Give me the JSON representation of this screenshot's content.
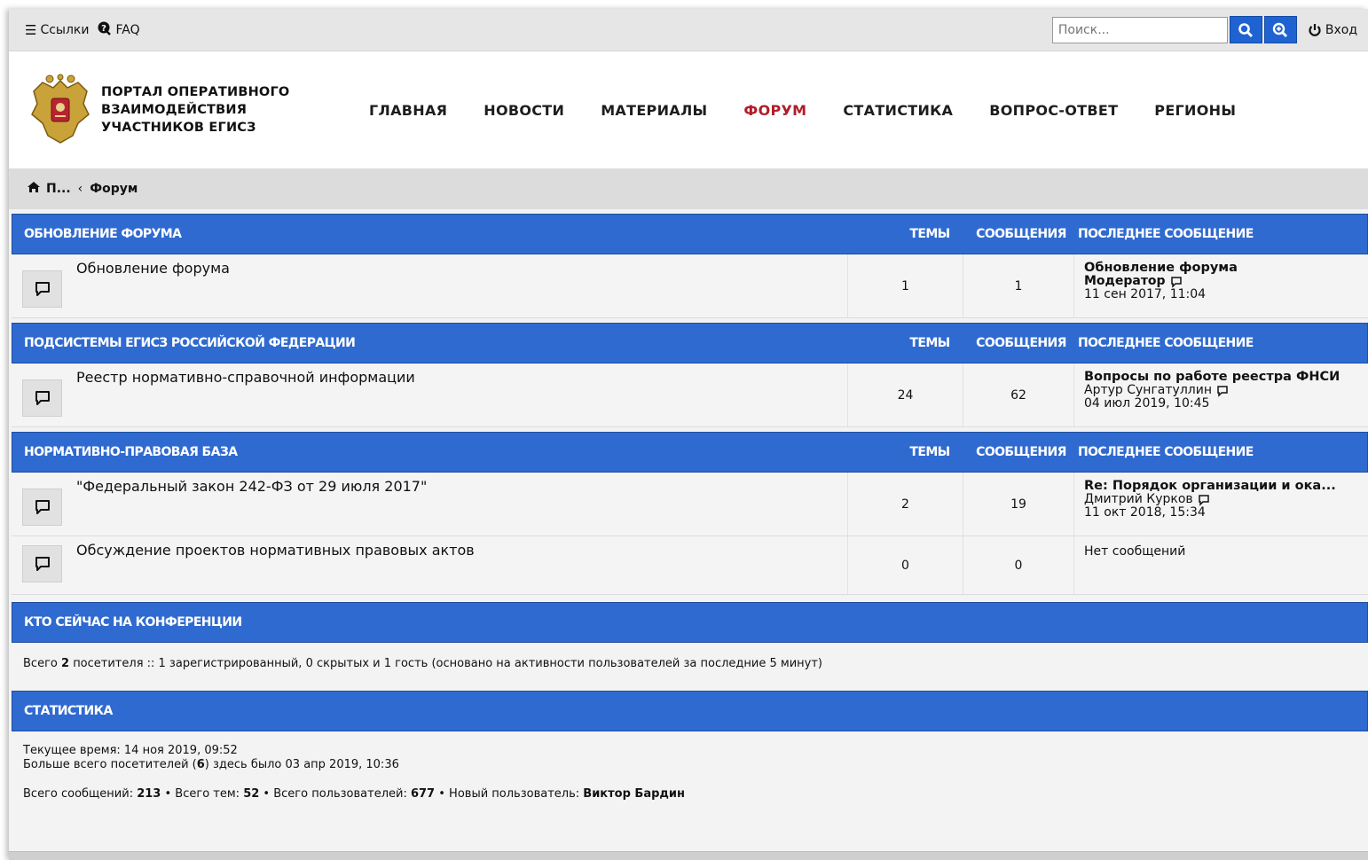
{
  "topbar": {
    "links_label": "Ссылки",
    "faq_label": "FAQ",
    "search_placeholder": "Поиск...",
    "login_label": "Вход"
  },
  "header": {
    "brand_line1": "ПОРТАЛ ОПЕРАТИВНОГО",
    "brand_line2": "ВЗАИМОДЕЙСТВИЯ",
    "brand_line3": "УЧАСТНИКОВ ЕГИСЗ",
    "nav": [
      {
        "label": "ГЛАВНАЯ"
      },
      {
        "label": "НОВОСТИ"
      },
      {
        "label": "МАТЕРИАЛЫ"
      },
      {
        "label": "ФОРУМ"
      },
      {
        "label": "СТАТИСТИКА"
      },
      {
        "label": "ВОПРОС-ОТВЕТ"
      },
      {
        "label": "РЕГИОНЫ"
      }
    ]
  },
  "breadcrumb": {
    "home": "П...",
    "separator": "‹",
    "current": "Форум"
  },
  "columns": {
    "topics": "ТЕМЫ",
    "posts": "СООБЩЕНИЯ",
    "last": "ПОСЛЕДНЕЕ СООБЩЕНИЕ"
  },
  "categories": [
    {
      "title": "ОБНОВЛЕНИЕ ФОРУМА",
      "forums": [
        {
          "name": "Обновление форума",
          "topics": "1",
          "posts": "1",
          "last_title": "Обновление форума",
          "last_author": "Модератор",
          "last_date": "11 сен 2017, 11:04"
        }
      ]
    },
    {
      "title": "ПОДСИСТЕМЫ ЕГИСЗ РОССИЙСКОЙ ФЕДЕРАЦИИ",
      "forums": [
        {
          "name": "Реестр нормативно-справочной информации",
          "topics": "24",
          "posts": "62",
          "last_title": "Вопросы по работе реестра ФНСИ",
          "last_author": "Артур Сунгатуллин",
          "last_date": "04 июл 2019, 10:45"
        }
      ]
    },
    {
      "title": "НОРМАТИВНО-ПРАВОВАЯ БАЗА",
      "forums": [
        {
          "name": "\"Федеральный закон 242-ФЗ от 29 июля 2017\"",
          "topics": "2",
          "posts": "19",
          "last_title": "Re: Порядок организации и ока...",
          "last_author": "Дмитрий Курков",
          "last_date": "11 окт 2018, 15:34"
        },
        {
          "name": "Обсуждение проектов нормативных правовых актов",
          "topics": "0",
          "posts": "0",
          "no_posts": "Нет сообщений"
        }
      ]
    }
  ],
  "online": {
    "title": "КТО СЕЙЧАС НА КОНФЕРЕНЦИИ",
    "prefix": "Всего",
    "count": "2",
    "rest": "посетителя :: 1 зарегистрированный, 0 скрытых и 1 гость (основано на активности пользователей за последние 5 минут)"
  },
  "statistics": {
    "title": "СТАТИСТИКА",
    "current_time": "Текущее время: 14 ноя 2019, 09:52",
    "max_prefix": "Больше всего посетителей (",
    "max_count": "6",
    "max_suffix": ") здесь было 03 апр 2019, 10:36",
    "posts_label": "Всего сообщений:",
    "posts_value": "213",
    "topics_label": "• Всего тем:",
    "topics_value": "52",
    "users_label": "• Всего пользователей:",
    "users_value": "677",
    "newest_label": "• Новый пользователь:",
    "newest_value": "Виктор Бардин"
  },
  "colors": {
    "accent": "#2f6ad0",
    "active_nav": "#b11d2a"
  }
}
